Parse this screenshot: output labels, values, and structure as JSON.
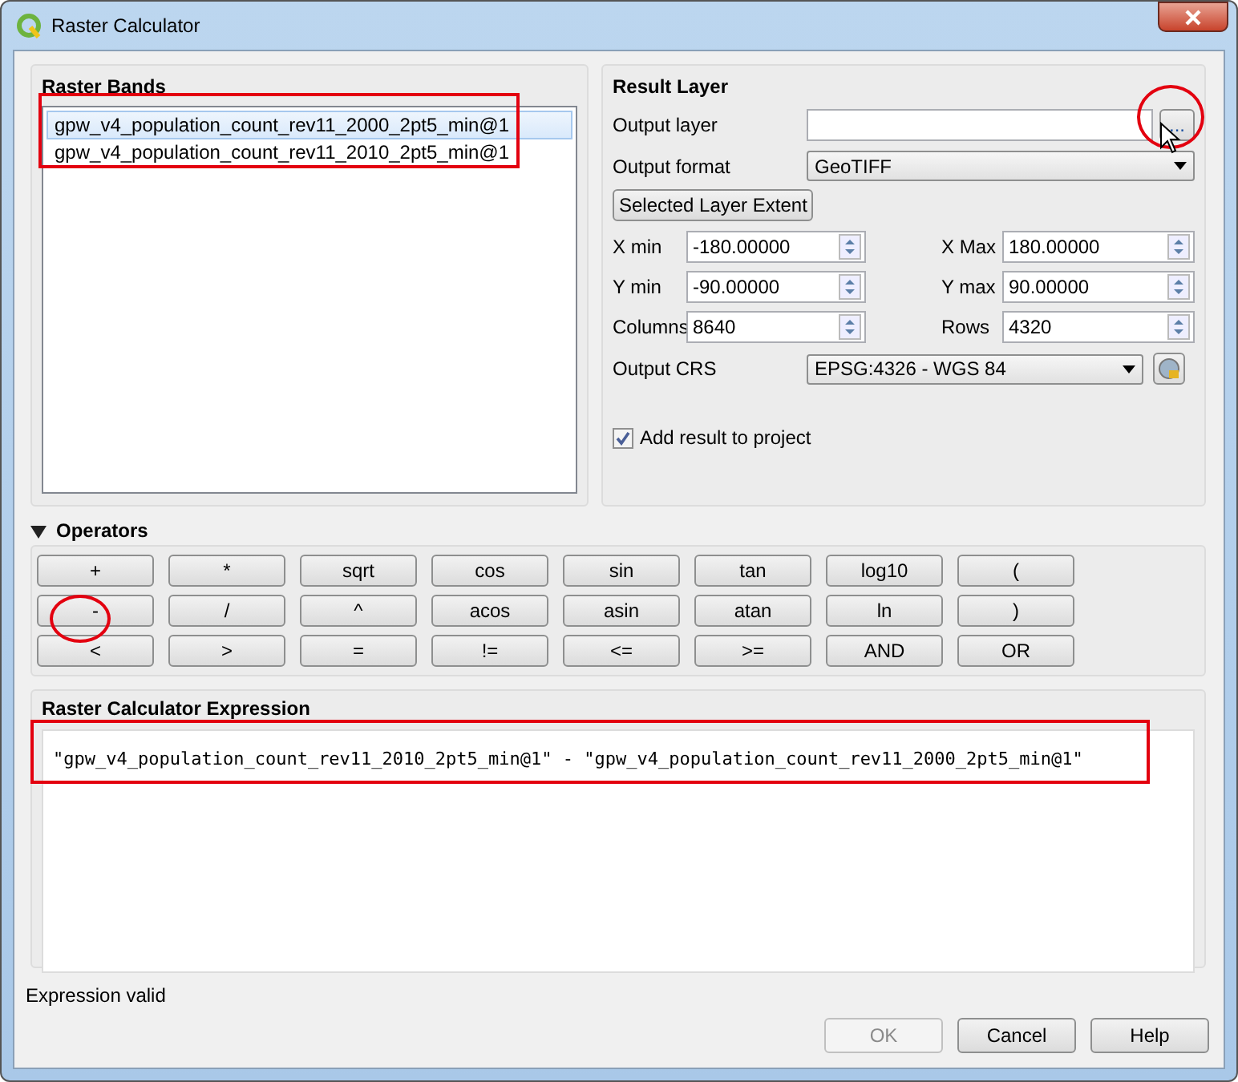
{
  "window": {
    "title": "Raster Calculator"
  },
  "raster_bands": {
    "title": "Raster Bands",
    "annotated": true,
    "items": [
      {
        "label": "gpw_v4_population_count_rev11_2000_2pt5_min@1",
        "selected": true
      },
      {
        "label": "gpw_v4_population_count_rev11_2010_2pt5_min@1",
        "selected": false
      }
    ]
  },
  "result_layer": {
    "title": "Result Layer",
    "output_layer": {
      "label": "Output layer",
      "browse_button": "...",
      "annotated": true
    },
    "output_format": {
      "label": "Output format",
      "value": "GeoTIFF"
    },
    "extent_button": "Selected Layer Extent",
    "extent_fields": [
      {
        "label": "X min",
        "value": "-180.00000"
      },
      {
        "label": "X Max",
        "value": "180.00000"
      },
      {
        "label": "Y min",
        "value": "-90.00000"
      },
      {
        "label": "Y max",
        "value": "90.00000"
      },
      {
        "label": "Columns",
        "value": "8640"
      },
      {
        "label": "Rows",
        "value": "4320"
      }
    ],
    "output_crs": {
      "label": "Output CRS",
      "value": "EPSG:4326 - WGS 84"
    },
    "add_to_project": {
      "label": "Add result to project",
      "checked": true
    }
  },
  "operators": {
    "title": "Operators",
    "expanded": true,
    "buttons": [
      {
        "label": "+",
        "annotated": false
      },
      {
        "label": "*",
        "annotated": false
      },
      {
        "label": "sqrt",
        "annotated": false
      },
      {
        "label": "cos",
        "annotated": false
      },
      {
        "label": "sin",
        "annotated": false
      },
      {
        "label": "tan",
        "annotated": false
      },
      {
        "label": "log10",
        "annotated": false
      },
      {
        "label": "(",
        "annotated": false
      },
      {
        "label": "-",
        "annotated": true
      },
      {
        "label": "/",
        "annotated": false
      },
      {
        "label": "^",
        "annotated": false
      },
      {
        "label": "acos",
        "annotated": false
      },
      {
        "label": "asin",
        "annotated": false
      },
      {
        "label": "atan",
        "annotated": false
      },
      {
        "label": "ln",
        "annotated": false
      },
      {
        "label": ")",
        "annotated": false
      },
      {
        "label": "<",
        "annotated": false
      },
      {
        "label": ">",
        "annotated": false
      },
      {
        "label": "=",
        "annotated": false
      },
      {
        "label": "!=",
        "annotated": false
      },
      {
        "label": "<=",
        "annotated": false
      },
      {
        "label": ">=",
        "annotated": false
      },
      {
        "label": "AND",
        "annotated": false
      },
      {
        "label": "OR",
        "annotated": false
      }
    ]
  },
  "expression": {
    "title": "Raster Calculator Expression",
    "text": "\"gpw_v4_population_count_rev11_2010_2pt5_min@1\" - \"gpw_v4_population_count_rev11_2000_2pt5_min@1\"",
    "annotated": true
  },
  "status": "Expression valid",
  "buttons": [
    {
      "label": "OK",
      "disabled": true
    },
    {
      "label": "Cancel",
      "disabled": false
    },
    {
      "label": "Help",
      "disabled": false
    }
  ]
}
